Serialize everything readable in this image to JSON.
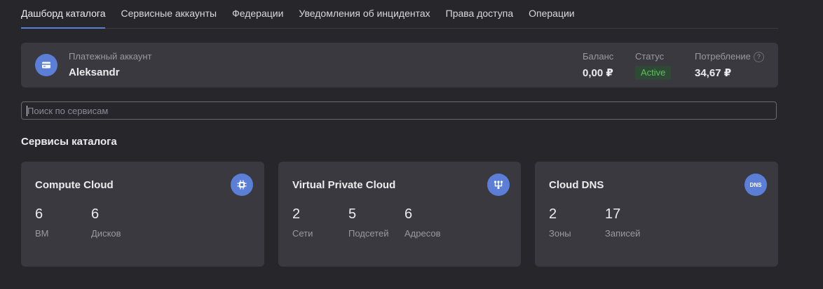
{
  "tabs": [
    {
      "label": "Дашборд каталога",
      "active": true
    },
    {
      "label": "Сервисные аккаунты",
      "active": false
    },
    {
      "label": "Федерации",
      "active": false
    },
    {
      "label": "Уведомления об инцидентах",
      "active": false
    },
    {
      "label": "Права доступа",
      "active": false
    },
    {
      "label": "Операции",
      "active": false
    }
  ],
  "billing": {
    "icon": "credit-card-icon",
    "label": "Платежный аккаунт",
    "name": "Aleksandr",
    "balance_label": "Баланс",
    "balance_value": "0,00 ₽",
    "status_label": "Статус",
    "status_value": "Active",
    "consumption_label": "Потребление",
    "consumption_value": "34,67 ₽",
    "help_glyph": "?"
  },
  "search": {
    "placeholder": "Поиск по сервисам",
    "value": ""
  },
  "section_title": "Сервисы каталога",
  "cards": [
    {
      "title": "Compute Cloud",
      "icon": "chip-icon",
      "metrics": [
        {
          "value": "6",
          "label": "ВМ"
        },
        {
          "value": "6",
          "label": "Дисков"
        }
      ]
    },
    {
      "title": "Virtual Private Cloud",
      "icon": "network-icon",
      "metrics": [
        {
          "value": "2",
          "label": "Сети"
        },
        {
          "value": "5",
          "label": "Подсетей"
        },
        {
          "value": "6",
          "label": "Адресов"
        }
      ]
    },
    {
      "title": "Cloud DNS",
      "icon": "dns-icon",
      "icon_text": "DNS",
      "metrics": [
        {
          "value": "2",
          "label": "Зоны"
        },
        {
          "value": "17",
          "label": "Записей"
        }
      ]
    }
  ],
  "colors": {
    "accent": "#5b7fd6",
    "background": "#27262b",
    "card": "#3a393f",
    "status_active": "#5fbf5f"
  }
}
